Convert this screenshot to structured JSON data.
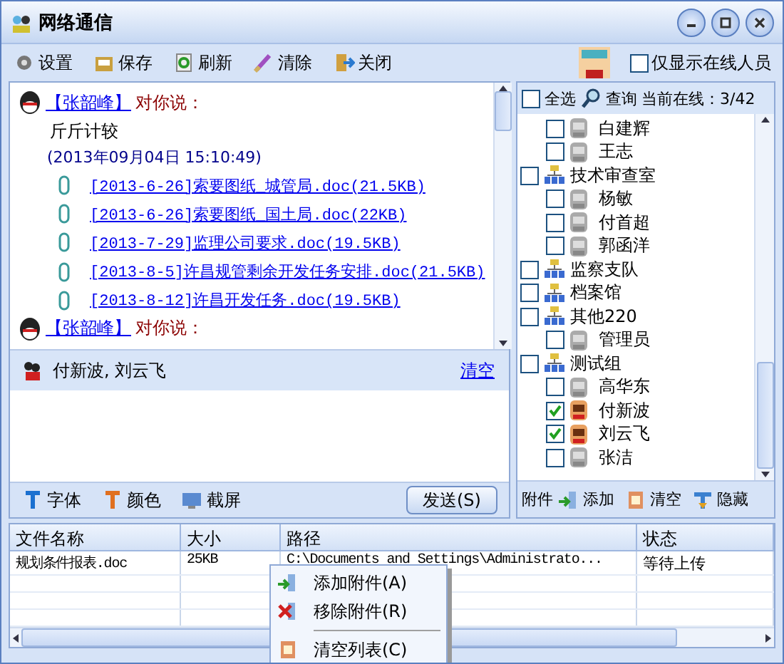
{
  "window": {
    "title": "网络通信"
  },
  "toolbar": [
    "设置",
    "保存",
    "刷新",
    "清除",
    "关闭"
  ],
  "online_only": {
    "label": "仅显示在线人员",
    "checked": false
  },
  "messages": [
    {
      "sender": "【张韶峰】",
      "verb": "对你说：",
      "text": "斤斤计较",
      "time": "(2013年09月04日 15:10:49)",
      "attachments": [
        "[2013-6-26]索要图纸_城管局.doc(21.5KB)",
        "[2013-6-26]索要图纸_国土局.doc(22KB)",
        "[2013-7-29]监理公司要求.doc(19.5KB)",
        "[2013-8-5]许昌规管剩余开发任务安排.doc(21.5KB)",
        "[2013-8-12]许昌开发任务.doc(19.5KB)"
      ]
    },
    {
      "sender": "【张韶峰】",
      "verb": "对你说："
    }
  ],
  "recipients": {
    "names": "付新波, 刘云飞",
    "clear_link": "清空"
  },
  "compose_tools": [
    "字体",
    "颜色",
    "截屏"
  ],
  "send_button": "发送(S)",
  "contacts": {
    "select_all": {
      "label": "全选",
      "checked": false
    },
    "search": "查询",
    "online_count": "当前在线：3/42",
    "tree": [
      {
        "children": [
          {
            "name": "白建辉",
            "checked": false,
            "online": false
          },
          {
            "name": "王志",
            "checked": false,
            "online": false
          }
        ]
      },
      {
        "name": "技术审查室",
        "checked": false,
        "children": [
          {
            "name": "杨敏",
            "checked": false,
            "online": false
          },
          {
            "name": "付首超",
            "checked": false,
            "online": false
          },
          {
            "name": "郭函洋",
            "checked": false,
            "online": false
          }
        ]
      },
      {
        "name": "监察支队",
        "checked": false
      },
      {
        "name": "档案馆",
        "checked": false
      },
      {
        "name": "其他220",
        "checked": false,
        "children": [
          {
            "name": "管理员",
            "checked": false,
            "online": false
          }
        ]
      },
      {
        "name": "测试组",
        "checked": false,
        "children": [
          {
            "name": "高华东",
            "checked": false,
            "online": false
          },
          {
            "name": "付新波",
            "checked": true,
            "online": true
          },
          {
            "name": "刘云飞",
            "checked": true,
            "online": true
          },
          {
            "name": "张洁",
            "checked": false,
            "online": false
          }
        ]
      }
    ],
    "attach_label": "附件",
    "actions": [
      "添加",
      "清空",
      "隐藏"
    ]
  },
  "files": {
    "columns": [
      "文件名称",
      "大小",
      "路径",
      "状态"
    ],
    "rows": [
      [
        "规划条件报表.doc",
        "25KB",
        "C:\\Documents and Settings\\Administrato...",
        "等待上传"
      ]
    ]
  },
  "context_menu": [
    {
      "label": "添加附件(A)",
      "divider_before": false
    },
    {
      "label": "移除附件(R)",
      "divider_before": false
    },
    {
      "label": "清空列表(C)",
      "divider_before": true
    }
  ]
}
